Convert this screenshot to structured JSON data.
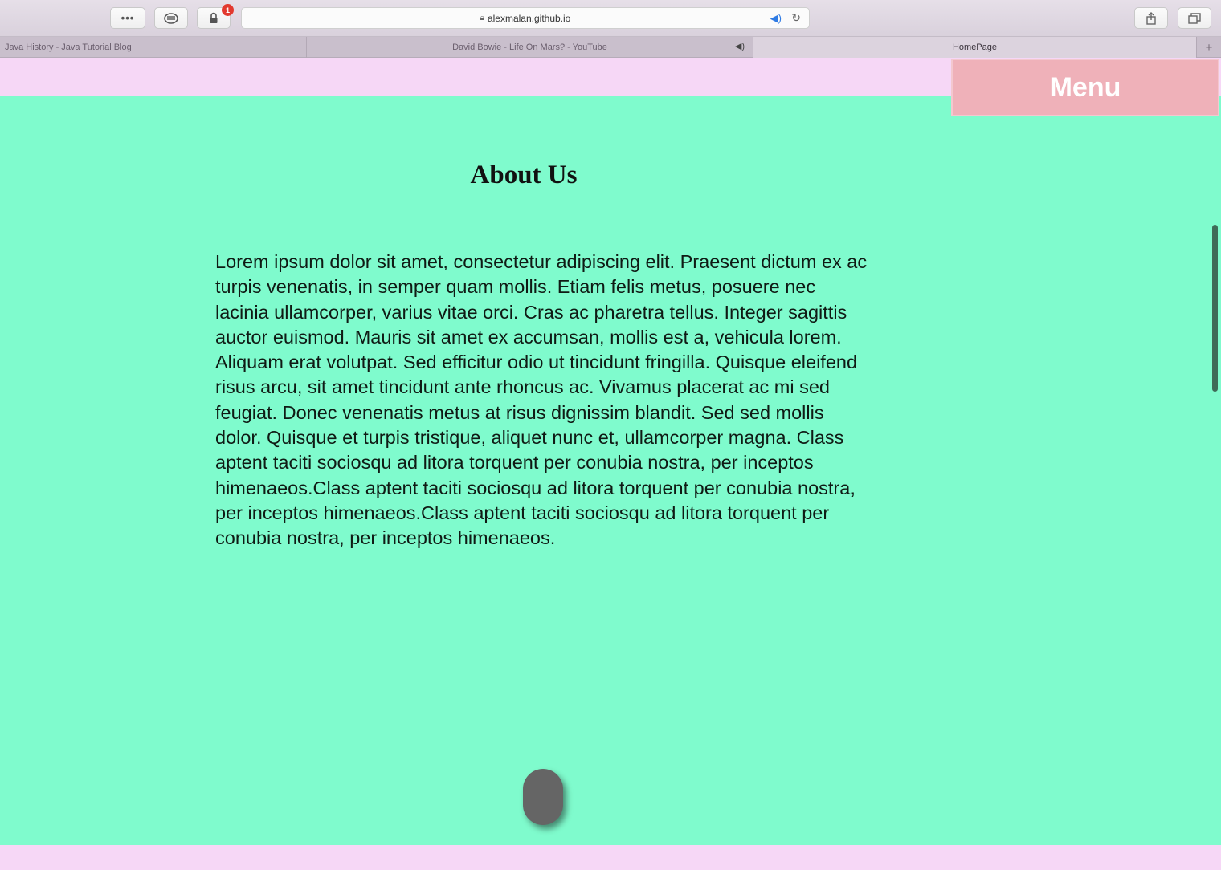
{
  "browser": {
    "toolbar": {
      "more_label": "•••",
      "reader_icon": "reader-icon",
      "lock_icon": "lock-icon",
      "lock_badge": "1",
      "address": "alexmalan.github.io",
      "audio_icon": "speaker-icon",
      "reload_icon": "reload-icon",
      "share_icon": "share-icon",
      "tabs_icon": "tabs-overview-icon"
    },
    "tabs": [
      {
        "title": "Java History - Java Tutorial Blog",
        "active": false
      },
      {
        "title": "David Bowie - Life On Mars? - YouTube",
        "active": false,
        "audio": true
      },
      {
        "title": "HomePage",
        "active": true
      }
    ],
    "new_tab_label": "+"
  },
  "page": {
    "menu_label": "Menu",
    "title": "About Us",
    "body": "Lorem ipsum dolor sit amet, consectetur adipiscing elit. Praesent dictum ex ac turpis venenatis, in semper quam mollis. Etiam felis metus, posuere nec lacinia ullamcorper, varius vitae orci. Cras ac pharetra tellus. Integer sagittis auctor euismod. Mauris sit amet ex accumsan, mollis est a, vehicula lorem. Aliquam erat volutpat. Sed efficitur odio ut tincidunt fringilla. Quisque eleifend risus arcu, sit amet tincidunt ante rhoncus ac. Vivamus placerat ac mi sed feugiat. Donec venenatis metus at risus dignissim blandit. Sed sed mollis dolor. Quisque et turpis tristique, aliquet nunc et, ullamcorper magna. Class aptent taciti sociosqu ad litora torquent per conubia nostra, per inceptos himenaeos.Class aptent taciti sociosqu ad litora torquent per conubia nostra, per inceptos himenaeos.Class aptent taciti sociosqu ad litora torquent per conubia nostra, per inceptos himenaeos."
  },
  "colors": {
    "page_background": "#7ffbcd",
    "header_background": "#f6d7f6",
    "menu_background": "#efb1b9"
  }
}
